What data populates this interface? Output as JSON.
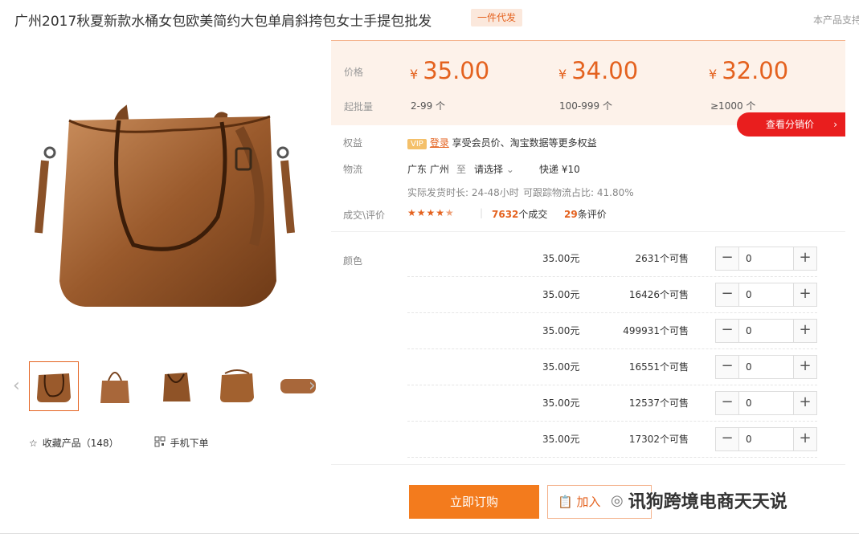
{
  "product": {
    "title": "广州2017秋夏新款水桶女包欧美简约大包单肩斜挎包女士手提包批发",
    "tag": "一件代发",
    "support_text": "本产品支持"
  },
  "prices": {
    "price_label": "价格",
    "batch_label": "起批量",
    "tiers": [
      {
        "currency": "¥",
        "price": "35.00",
        "batch": "2-99 个"
      },
      {
        "currency": "¥",
        "price": "34.00",
        "batch": "100-999 个"
      },
      {
        "currency": "¥",
        "price": "32.00",
        "batch": "≥1000 个"
      }
    ],
    "distribution_button": "查看分销价"
  },
  "benefits": {
    "label": "权益",
    "vip": "VIP",
    "login": "登录",
    "text": "享受会员价、淘宝数据等更多权益"
  },
  "logistics": {
    "label": "物流",
    "from": "广东 广州",
    "to": "至",
    "select": "请选择",
    "express": "快递 ¥10",
    "ship_time": "实际发货时长: 24-48小时",
    "tracking": "可跟踪物流占比: 41.80%"
  },
  "reviews": {
    "label": "成交\\评价",
    "rating_stars": 4.5,
    "deals_count": "7632",
    "deals_suffix": "个成交",
    "review_count": "29",
    "review_suffix": "条评价"
  },
  "sku": {
    "label": "颜色",
    "rows": [
      {
        "price": "35.00元",
        "stock": "2631个可售",
        "qty": "0"
      },
      {
        "price": "35.00元",
        "stock": "16426个可售",
        "qty": "0"
      },
      {
        "price": "35.00元",
        "stock": "499931个可售",
        "qty": "0"
      },
      {
        "price": "35.00元",
        "stock": "16551个可售",
        "qty": "0"
      },
      {
        "price": "35.00元",
        "stock": "12537个可售",
        "qty": "0"
      },
      {
        "price": "35.00元",
        "stock": "17302个可售",
        "qty": "0"
      }
    ]
  },
  "actions": {
    "buy_now": "立即订购",
    "add_cart": "加入"
  },
  "left_actions": {
    "favorite": "收藏产品（148）",
    "mobile": "手机下单"
  },
  "watermark": "讯狗跨境电商天天说",
  "colors": {
    "accent": "#e4621f",
    "buy": "#f37b1d",
    "red": "#e91e1e"
  }
}
